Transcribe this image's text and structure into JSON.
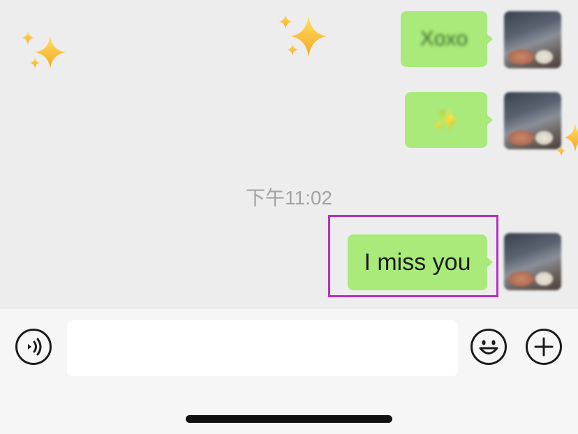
{
  "messages": [
    {
      "text": "Xoxo",
      "sender": "self",
      "blurred": true
    },
    {
      "text": "✨",
      "sender": "self",
      "blurred": true
    },
    {
      "text": "I miss you",
      "sender": "self",
      "blurred": false,
      "highlighted": true
    }
  ],
  "timestamp": "下午11:02",
  "input": {
    "value": "",
    "placeholder": ""
  },
  "icons": {
    "voice": "voice-input-icon",
    "emoji": "emoji-icon",
    "plus": "plus-icon",
    "sparkle": "sparkles-icon"
  },
  "colors": {
    "bubble": "#a9ea7a",
    "background": "#ededed",
    "highlight": "#b62ec4"
  }
}
